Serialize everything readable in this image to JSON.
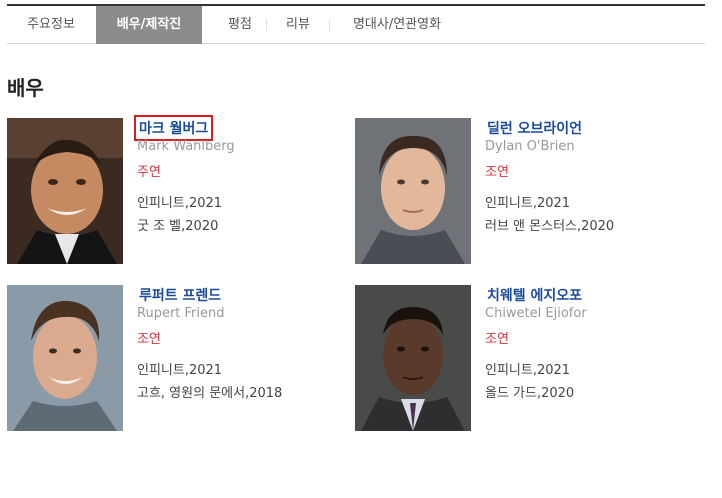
{
  "tabs": [
    {
      "label": "주요정보",
      "active": false
    },
    {
      "label": "배우/제작진",
      "active": true
    },
    {
      "label": "평점",
      "active": false
    },
    {
      "label": "리뷰",
      "active": false
    },
    {
      "label": "명대사/연관영화",
      "active": false
    }
  ],
  "section_title": "배우",
  "actors": [
    {
      "name": "마크 월버그",
      "english_name": "Mark Wahlberg",
      "role": "주연",
      "films": [
        "인피니트,2021",
        "굿 조 벨,2020"
      ],
      "highlighted": true
    },
    {
      "name": "딜런 오브라이언",
      "english_name": "Dylan O'Brien",
      "role": "조연",
      "films": [
        "인피니트,2021",
        "러브 앤 몬스터스,2020"
      ],
      "highlighted": false
    },
    {
      "name": "루퍼트 프렌드",
      "english_name": "Rupert Friend",
      "role": "조연",
      "films": [
        "인피니트,2021",
        "고흐, 영원의 문에서,2018"
      ],
      "highlighted": false
    },
    {
      "name": "치웨텔 에지오포",
      "english_name": "Chiwetel Ejiofor",
      "role": "조연",
      "films": [
        "인피니트,2021",
        "올드 가드,2020"
      ],
      "highlighted": false
    }
  ],
  "colors": {
    "active_tab_bg": "#8c8c8c",
    "name_link": "#1a4b9b",
    "role": "#d0363e",
    "highlight_box": "#d81e1e"
  }
}
